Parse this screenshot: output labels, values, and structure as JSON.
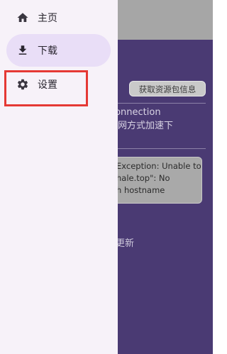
{
  "background_app": {
    "get_resource_button": "获取资源包信息",
    "description_lines": [
      "如Connection",
      "学上网方式加速下"
    ],
    "error_lines": [
      "Exception: Unable to",
      "hale.top\": No",
      "h hostname"
    ],
    "update_text": "需更新"
  },
  "drawer": {
    "items": [
      {
        "label": "主页",
        "icon": "home-icon",
        "active": false
      },
      {
        "label": "下载",
        "icon": "download-icon",
        "active": true
      },
      {
        "label": "设置",
        "icon": "settings-gear-icon",
        "active": false
      }
    ]
  },
  "colors": {
    "drawer_bg": "#f7f2f9",
    "active_item_bg": "#e9def7",
    "app_content_bg": "#4a3a73",
    "highlight_border": "#e53935"
  }
}
